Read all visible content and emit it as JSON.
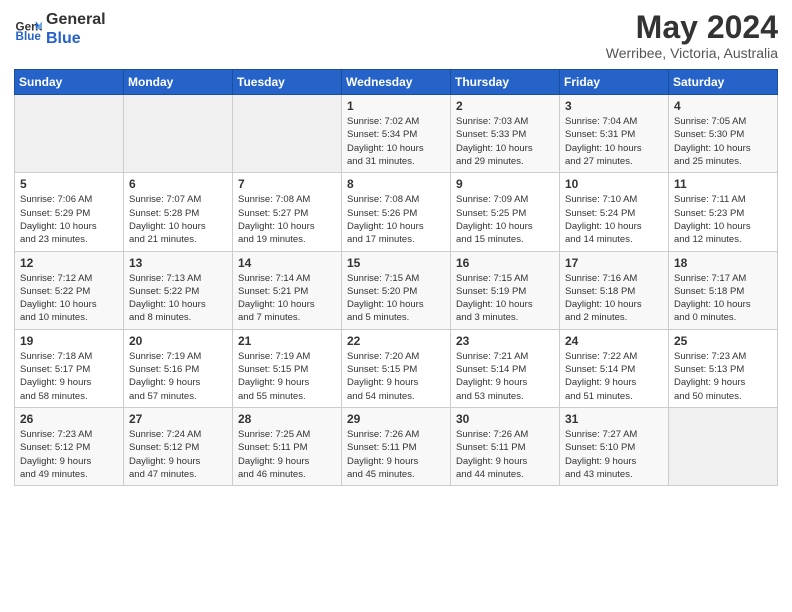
{
  "logo": {
    "text_general": "General",
    "text_blue": "Blue"
  },
  "header": {
    "month_year": "May 2024",
    "location": "Werribee, Victoria, Australia"
  },
  "days_of_week": [
    "Sunday",
    "Monday",
    "Tuesday",
    "Wednesday",
    "Thursday",
    "Friday",
    "Saturday"
  ],
  "weeks": [
    {
      "row_bg": "light",
      "days": [
        {
          "num": "",
          "info": "",
          "empty": true
        },
        {
          "num": "",
          "info": "",
          "empty": true
        },
        {
          "num": "",
          "info": "",
          "empty": true
        },
        {
          "num": "1",
          "info": "Sunrise: 7:02 AM\nSunset: 5:34 PM\nDaylight: 10 hours\nand 31 minutes."
        },
        {
          "num": "2",
          "info": "Sunrise: 7:03 AM\nSunset: 5:33 PM\nDaylight: 10 hours\nand 29 minutes."
        },
        {
          "num": "3",
          "info": "Sunrise: 7:04 AM\nSunset: 5:31 PM\nDaylight: 10 hours\nand 27 minutes."
        },
        {
          "num": "4",
          "info": "Sunrise: 7:05 AM\nSunset: 5:30 PM\nDaylight: 10 hours\nand 25 minutes."
        }
      ]
    },
    {
      "row_bg": "white",
      "days": [
        {
          "num": "5",
          "info": "Sunrise: 7:06 AM\nSunset: 5:29 PM\nDaylight: 10 hours\nand 23 minutes."
        },
        {
          "num": "6",
          "info": "Sunrise: 7:07 AM\nSunset: 5:28 PM\nDaylight: 10 hours\nand 21 minutes."
        },
        {
          "num": "7",
          "info": "Sunrise: 7:08 AM\nSunset: 5:27 PM\nDaylight: 10 hours\nand 19 minutes."
        },
        {
          "num": "8",
          "info": "Sunrise: 7:08 AM\nSunset: 5:26 PM\nDaylight: 10 hours\nand 17 minutes."
        },
        {
          "num": "9",
          "info": "Sunrise: 7:09 AM\nSunset: 5:25 PM\nDaylight: 10 hours\nand 15 minutes."
        },
        {
          "num": "10",
          "info": "Sunrise: 7:10 AM\nSunset: 5:24 PM\nDaylight: 10 hours\nand 14 minutes."
        },
        {
          "num": "11",
          "info": "Sunrise: 7:11 AM\nSunset: 5:23 PM\nDaylight: 10 hours\nand 12 minutes."
        }
      ]
    },
    {
      "row_bg": "light",
      "days": [
        {
          "num": "12",
          "info": "Sunrise: 7:12 AM\nSunset: 5:22 PM\nDaylight: 10 hours\nand 10 minutes."
        },
        {
          "num": "13",
          "info": "Sunrise: 7:13 AM\nSunset: 5:22 PM\nDaylight: 10 hours\nand 8 minutes."
        },
        {
          "num": "14",
          "info": "Sunrise: 7:14 AM\nSunset: 5:21 PM\nDaylight: 10 hours\nand 7 minutes."
        },
        {
          "num": "15",
          "info": "Sunrise: 7:15 AM\nSunset: 5:20 PM\nDaylight: 10 hours\nand 5 minutes."
        },
        {
          "num": "16",
          "info": "Sunrise: 7:15 AM\nSunset: 5:19 PM\nDaylight: 10 hours\nand 3 minutes."
        },
        {
          "num": "17",
          "info": "Sunrise: 7:16 AM\nSunset: 5:18 PM\nDaylight: 10 hours\nand 2 minutes."
        },
        {
          "num": "18",
          "info": "Sunrise: 7:17 AM\nSunset: 5:18 PM\nDaylight: 10 hours\nand 0 minutes."
        }
      ]
    },
    {
      "row_bg": "white",
      "days": [
        {
          "num": "19",
          "info": "Sunrise: 7:18 AM\nSunset: 5:17 PM\nDaylight: 9 hours\nand 58 minutes."
        },
        {
          "num": "20",
          "info": "Sunrise: 7:19 AM\nSunset: 5:16 PM\nDaylight: 9 hours\nand 57 minutes."
        },
        {
          "num": "21",
          "info": "Sunrise: 7:19 AM\nSunset: 5:15 PM\nDaylight: 9 hours\nand 55 minutes."
        },
        {
          "num": "22",
          "info": "Sunrise: 7:20 AM\nSunset: 5:15 PM\nDaylight: 9 hours\nand 54 minutes."
        },
        {
          "num": "23",
          "info": "Sunrise: 7:21 AM\nSunset: 5:14 PM\nDaylight: 9 hours\nand 53 minutes."
        },
        {
          "num": "24",
          "info": "Sunrise: 7:22 AM\nSunset: 5:14 PM\nDaylight: 9 hours\nand 51 minutes."
        },
        {
          "num": "25",
          "info": "Sunrise: 7:23 AM\nSunset: 5:13 PM\nDaylight: 9 hours\nand 50 minutes."
        }
      ]
    },
    {
      "row_bg": "light",
      "days": [
        {
          "num": "26",
          "info": "Sunrise: 7:23 AM\nSunset: 5:12 PM\nDaylight: 9 hours\nand 49 minutes."
        },
        {
          "num": "27",
          "info": "Sunrise: 7:24 AM\nSunset: 5:12 PM\nDaylight: 9 hours\nand 47 minutes."
        },
        {
          "num": "28",
          "info": "Sunrise: 7:25 AM\nSunset: 5:11 PM\nDaylight: 9 hours\nand 46 minutes."
        },
        {
          "num": "29",
          "info": "Sunrise: 7:26 AM\nSunset: 5:11 PM\nDaylight: 9 hours\nand 45 minutes."
        },
        {
          "num": "30",
          "info": "Sunrise: 7:26 AM\nSunset: 5:11 PM\nDaylight: 9 hours\nand 44 minutes."
        },
        {
          "num": "31",
          "info": "Sunrise: 7:27 AM\nSunset: 5:10 PM\nDaylight: 9 hours\nand 43 minutes."
        },
        {
          "num": "",
          "info": "",
          "empty": true
        }
      ]
    }
  ]
}
